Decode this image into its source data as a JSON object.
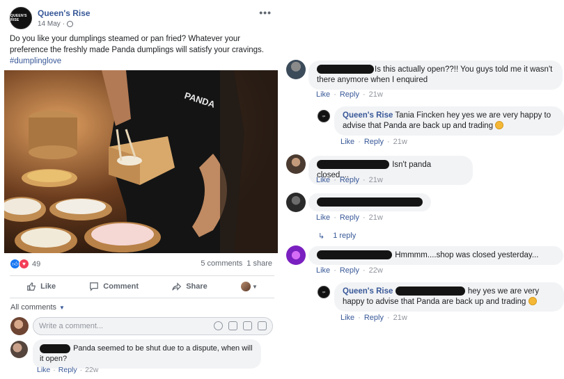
{
  "post": {
    "page_name": "Queen's Rise",
    "avatar_text": "QUEEN'S RISE",
    "date": "14 May",
    "text": "Do you like your dumplings steamed or pan fried? Whatever your preference the freshly made Panda dumplings will satisfy your cravings.",
    "hashtag": "#dumplinglove",
    "photo_apron_text": "PANDA",
    "reaction_count": "49",
    "comments_count": "5 comments",
    "shares_count": "1 share",
    "actions": {
      "like": "Like",
      "comment": "Comment",
      "share": "Share"
    },
    "all_comments": "All comments",
    "composer_placeholder": "Write a comment...",
    "comment": {
      "text": "Panda seemed to be shut due to a dispute, when will it open?",
      "like": "Like",
      "reply": "Reply",
      "time": "22w"
    }
  },
  "thread": {
    "c1": {
      "text": "Is this actually open??!! You guys told me it wasn't there anymore when I enquired",
      "like": "Like",
      "reply": "Reply",
      "time": "21w"
    },
    "r1": {
      "author": "Queen's Rise",
      "text": "Tania Fincken hey yes we are very happy to advise that Panda are back up and trading",
      "like": "Like",
      "reply": "Reply",
      "time": "21w"
    },
    "c2": {
      "text": "Isn't panda closed....",
      "like": "Like",
      "reply": "Reply",
      "time": "21w"
    },
    "c3": {
      "like": "Like",
      "reply": "Reply",
      "time": "21w",
      "replies": "1 reply"
    },
    "c4": {
      "text": "Hmmmm....shop was closed yesterday...",
      "like": "Like",
      "reply": "Reply",
      "time": "22w"
    },
    "r2": {
      "author": "Queen's Rise",
      "text": "hey yes we are very happy to advise that Panda are back up and trading",
      "like": "Like",
      "reply": "Reply",
      "time": "21w"
    }
  },
  "colors": {
    "link": "#385898",
    "bubble": "#f2f3f5",
    "like_blue": "#1877f2",
    "love_red": "#f33e58"
  }
}
